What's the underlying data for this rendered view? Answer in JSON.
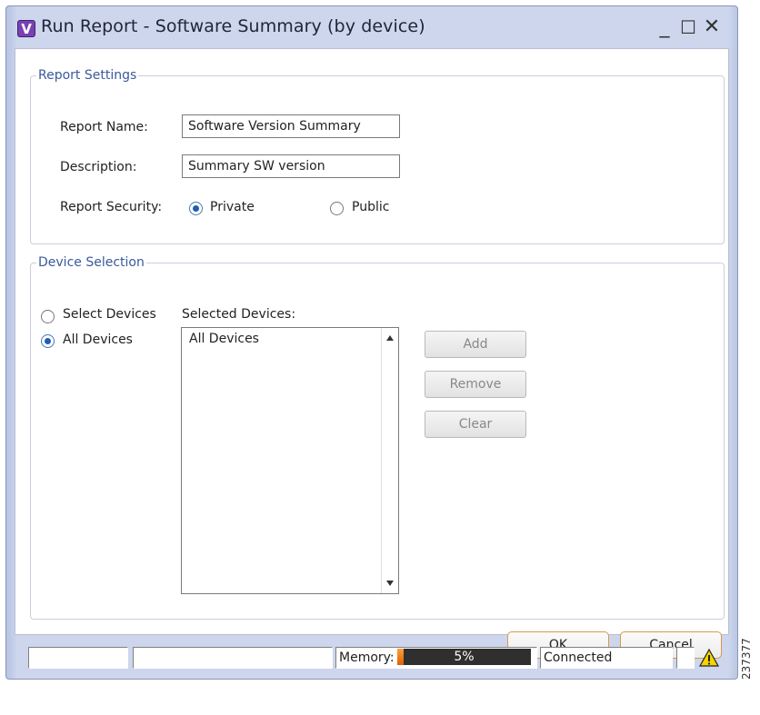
{
  "window": {
    "title": "Run Report - Software Summary (by device)",
    "app_icon_letter": "V",
    "controls": {
      "minimize": "_",
      "maximize": "☐",
      "close": "✕"
    }
  },
  "report_settings": {
    "legend": "Report Settings",
    "name_label": "Report Name:",
    "name_value": "Software Version Summary",
    "description_label": "Description:",
    "description_value": "Summary SW version",
    "security_label": "Report Security:",
    "security_options": [
      {
        "label": "Private",
        "selected": true
      },
      {
        "label": "Public",
        "selected": false
      }
    ]
  },
  "device_selection": {
    "legend": "Device Selection",
    "mode_options": [
      {
        "label": "Select Devices",
        "selected": false
      },
      {
        "label": "All Devices",
        "selected": true
      }
    ],
    "selected_label": "Selected Devices:",
    "selected_items": [
      "All Devices"
    ],
    "buttons": {
      "add": "Add",
      "remove": "Remove",
      "clear": "Clear"
    }
  },
  "dialog_buttons": {
    "ok": "OK",
    "cancel": "Cancel"
  },
  "status_bar": {
    "memory_label": "Memory:",
    "memory_percent": "5%",
    "memory_fraction": 0.05,
    "connection": "Connected",
    "warning_icon": "warning-icon"
  },
  "side_id": "237377",
  "colors": {
    "accent": "#1a5fb4",
    "legend": "#3a5a9a",
    "memory_fill": "#e06000"
  }
}
